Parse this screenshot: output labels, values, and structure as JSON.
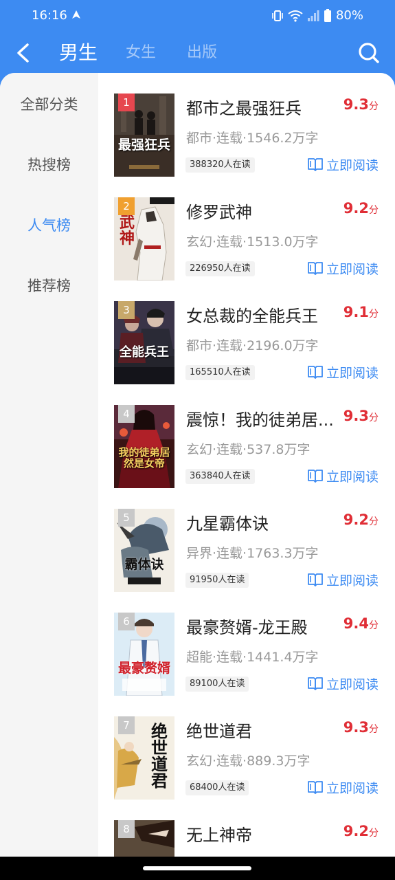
{
  "status": {
    "time": "16:16",
    "battery": "80%"
  },
  "header": {
    "tabs": [
      {
        "label": "男生",
        "active": true
      },
      {
        "label": "女生",
        "active": false
      },
      {
        "label": "出版",
        "active": false
      }
    ]
  },
  "sidebar": {
    "items": [
      {
        "label": "全部分类",
        "active": false
      },
      {
        "label": "热搜榜",
        "active": false
      },
      {
        "label": "人气榜",
        "active": true
      },
      {
        "label": "推荐榜",
        "active": false
      }
    ]
  },
  "books": [
    {
      "rank": "1",
      "title": "都市之最强狂兵",
      "score": "9.3",
      "unit": "分",
      "meta": "都市·连载·1546.2万字",
      "readers": "388320人在读",
      "read_label": "立即阅读"
    },
    {
      "rank": "2",
      "title": "修罗武神",
      "score": "9.2",
      "unit": "分",
      "meta": "玄幻·连载·1513.0万字",
      "readers": "226950人在读",
      "read_label": "立即阅读"
    },
    {
      "rank": "3",
      "title": "女总裁的全能兵王",
      "score": "9.1",
      "unit": "分",
      "meta": "都市·连载·2196.0万字",
      "readers": "165510人在读",
      "read_label": "立即阅读"
    },
    {
      "rank": "4",
      "title": "震惊！我的徒弟居...",
      "score": "9.3",
      "unit": "分",
      "meta": "玄幻·连载·537.8万字",
      "readers": "363840人在读",
      "read_label": "立即阅读"
    },
    {
      "rank": "5",
      "title": "九星霸体诀",
      "score": "9.2",
      "unit": "分",
      "meta": "异界·连载·1763.3万字",
      "readers": "91950人在读",
      "read_label": "立即阅读"
    },
    {
      "rank": "6",
      "title": "最豪赘婿-龙王殿",
      "score": "9.4",
      "unit": "分",
      "meta": "超能·连载·1441.4万字",
      "readers": "89100人在读",
      "read_label": "立即阅读"
    },
    {
      "rank": "7",
      "title": "绝世道君",
      "score": "9.3",
      "unit": "分",
      "meta": "玄幻·连载·889.3万字",
      "readers": "68400人在读",
      "read_label": "立即阅读"
    },
    {
      "rank": "8",
      "title": "无上神帝",
      "score": "9.2",
      "unit": "分",
      "meta": "",
      "readers": "",
      "read_label": ""
    }
  ],
  "cover_text": [
    "最强狂兵",
    "武神",
    "全能兵王",
    "我的徒弟居然是女帝",
    "霸体诀",
    "最豪赘婿",
    "绝世道君",
    ""
  ],
  "colors": {
    "accent": "#3d8bf2",
    "score": "#e02e36",
    "rank_1": "#e6474f",
    "rank_2": "#f0a030",
    "rank_3": "#c7a86a",
    "rank_other": "#c8c8c8"
  }
}
